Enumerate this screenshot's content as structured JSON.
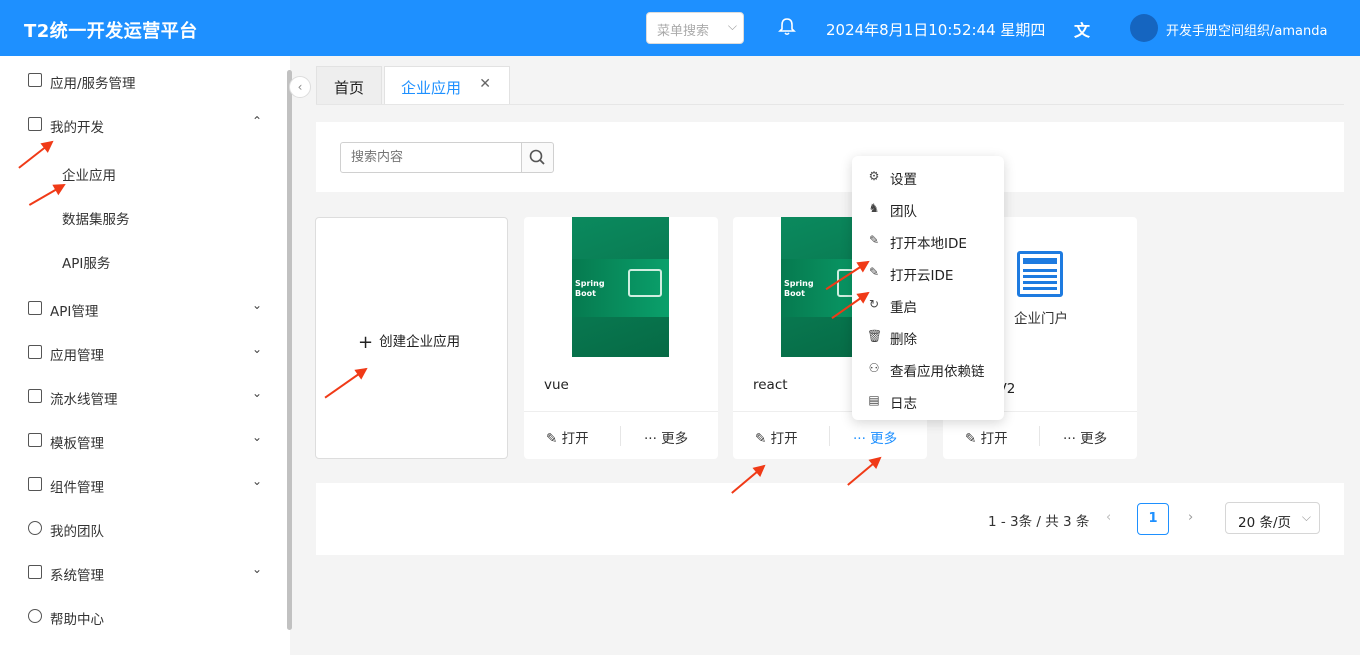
{
  "header": {
    "brand": "T2统一开发运营平台",
    "menu_search_placeholder": "菜单搜索",
    "datetime": "2024年8月1日10:52:44 星期四",
    "user": "开发手册空间组织/amanda"
  },
  "sidebar": {
    "items": [
      {
        "label": "应用/服务管理"
      },
      {
        "label": "我的开发"
      },
      {
        "label": "API管理"
      },
      {
        "label": "应用管理"
      },
      {
        "label": "流水线管理"
      },
      {
        "label": "模板管理"
      },
      {
        "label": "组件管理"
      },
      {
        "label": "我的团队"
      },
      {
        "label": "系统管理"
      },
      {
        "label": "帮助中心"
      }
    ],
    "subitems": [
      {
        "label": "企业应用"
      },
      {
        "label": "数据集服务"
      },
      {
        "label": "API服务"
      }
    ]
  },
  "tabs": [
    {
      "label": "首页"
    },
    {
      "label": "企业应用"
    }
  ],
  "search": {
    "placeholder": "搜索内容"
  },
  "create_card": {
    "label": "创建企业应用"
  },
  "cards": [
    {
      "name": "vue",
      "thumb_text": "Spring Boot",
      "open": "打开",
      "more": "更多"
    },
    {
      "name": "react",
      "thumb_text": "Spring Boot",
      "open": "打开",
      "more": "更多"
    },
    {
      "name": "企业门户V2",
      "name_visible": "户V2",
      "thumb_label": "企业门户",
      "open": "打开",
      "more": "更多"
    }
  ],
  "dropdown": [
    {
      "label": "设置",
      "icon": "gear-icon"
    },
    {
      "label": "团队",
      "icon": "team-icon"
    },
    {
      "label": "打开本地IDE",
      "icon": "edit-icon"
    },
    {
      "label": "打开云IDE",
      "icon": "edit-icon"
    },
    {
      "label": "重启",
      "icon": "refresh-icon"
    },
    {
      "label": "删除",
      "icon": "trash-icon"
    },
    {
      "label": "查看应用依赖链",
      "icon": "hierarchy-icon"
    },
    {
      "label": "日志",
      "icon": "log-icon"
    }
  ],
  "pagination": {
    "total": "1 - 3条 / 共 3 条",
    "current": "1",
    "page_size": "20 条/页"
  },
  "colors": {
    "primary": "#1e90ff",
    "annotation": "#f03a17"
  }
}
